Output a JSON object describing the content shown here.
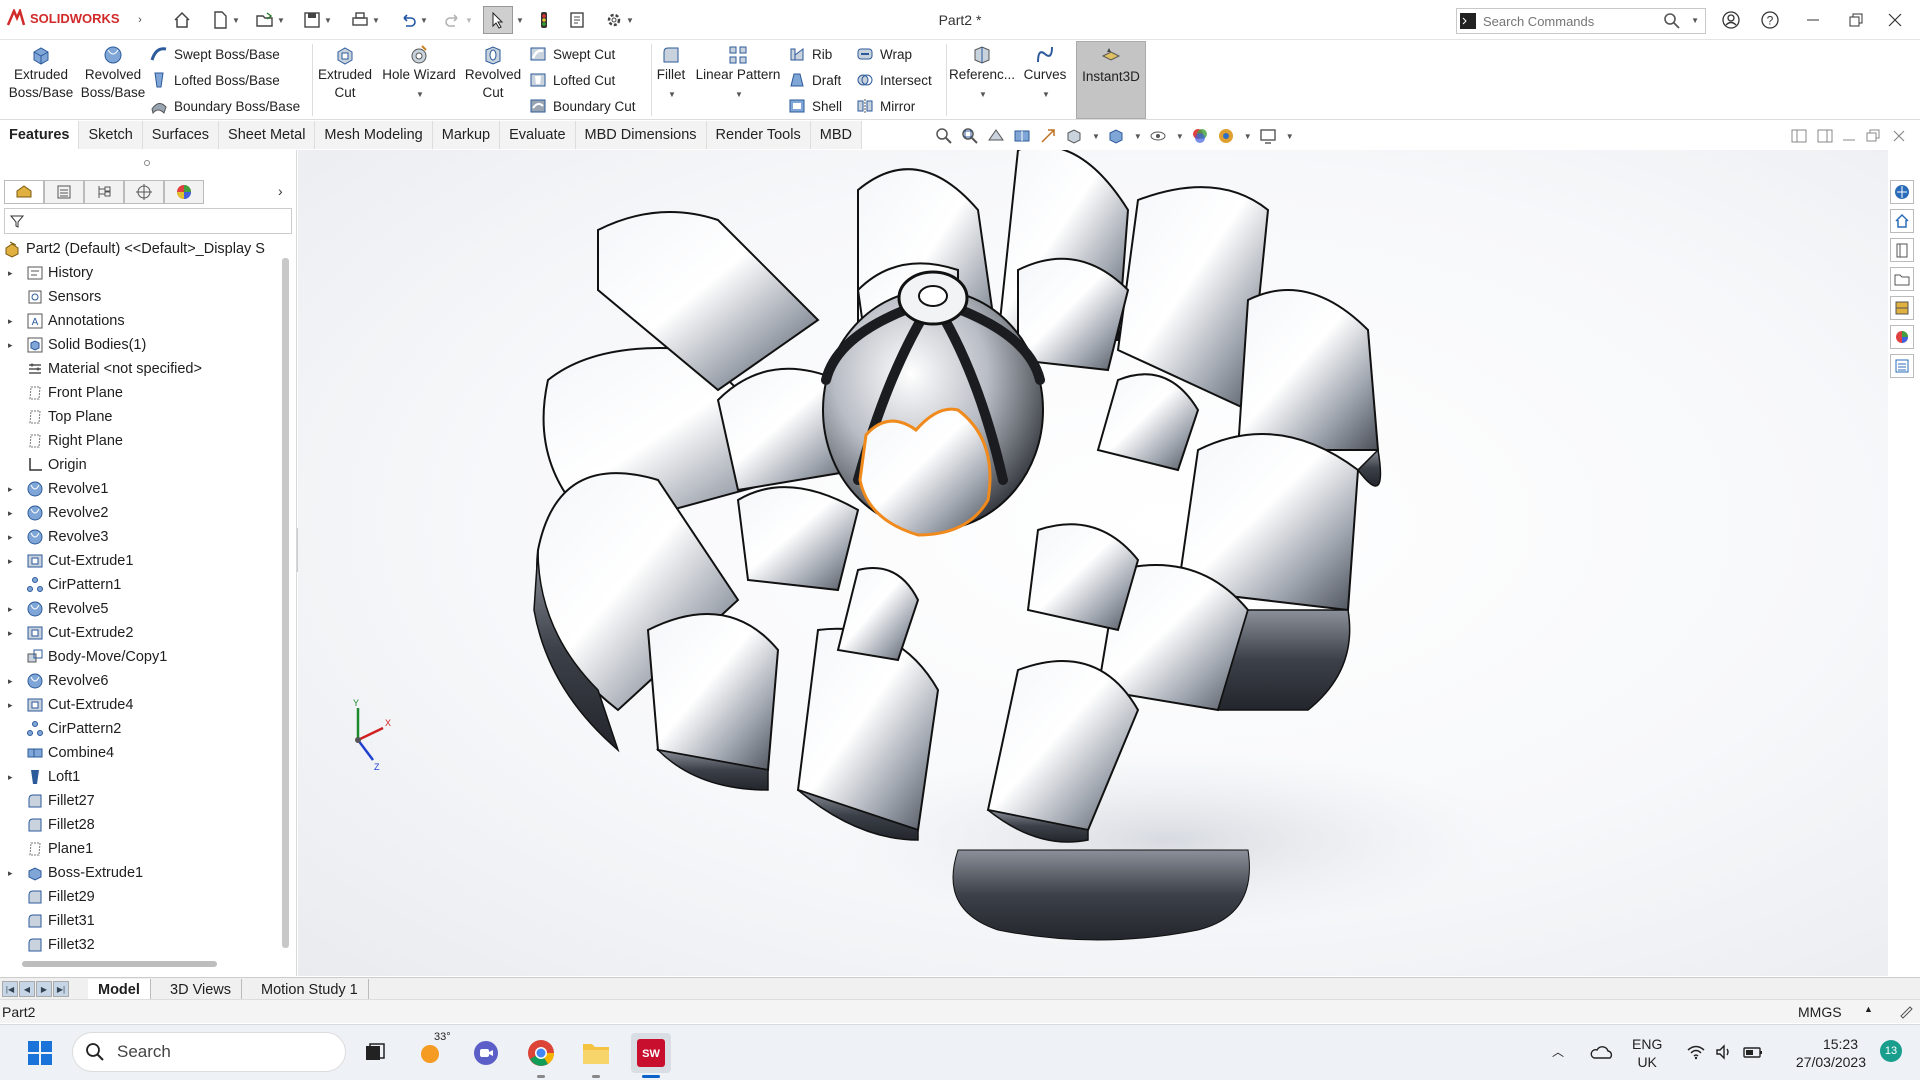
{
  "app": {
    "name": "SOLIDWORKS",
    "doc_title": "Part2 *",
    "search_placeholder": "Search Commands"
  },
  "command_manager": {
    "extruded_boss": "Extruded Boss/Base",
    "revolved_boss": "Revolved Boss/Base",
    "swept_boss": "Swept Boss/Base",
    "lofted_boss": "Lofted Boss/Base",
    "boundary_boss": "Boundary Boss/Base",
    "extruded_cut": "Extruded Cut",
    "hole_wizard": "Hole Wizard",
    "revolved_cut": "Revolved Cut",
    "swept_cut": "Swept Cut",
    "lofted_cut": "Lofted Cut",
    "boundary_cut": "Boundary Cut",
    "fillet": "Fillet",
    "linear_pattern": "Linear Pattern",
    "rib": "Rib",
    "draft": "Draft",
    "shell": "Shell",
    "wrap": "Wrap",
    "intersect": "Intersect",
    "mirror": "Mirror",
    "reference": "Referenc...",
    "curves": "Curves",
    "instant3d": "Instant3D"
  },
  "tabs": [
    "Features",
    "Sketch",
    "Surfaces",
    "Sheet Metal",
    "Mesh Modeling",
    "Markup",
    "Evaluate",
    "MBD Dimensions",
    "Render Tools",
    "MBD"
  ],
  "feature_tree": {
    "root": "Part2 (Default) <<Default>_Display S",
    "items": [
      {
        "label": "History",
        "icon": "history-icon",
        "expand": true
      },
      {
        "label": "Sensors",
        "icon": "sensor-icon",
        "expand": false
      },
      {
        "label": "Annotations",
        "icon": "annotations-icon",
        "expand": true
      },
      {
        "label": "Solid Bodies(1)",
        "icon": "solid-bodies-icon",
        "expand": true
      },
      {
        "label": "Material <not specified>",
        "icon": "material-icon",
        "expand": false
      },
      {
        "label": "Front Plane",
        "icon": "plane-icon",
        "expand": false
      },
      {
        "label": "Top Plane",
        "icon": "plane-icon",
        "expand": false
      },
      {
        "label": "Right Plane",
        "icon": "plane-icon",
        "expand": false
      },
      {
        "label": "Origin",
        "icon": "origin-icon",
        "expand": false
      },
      {
        "label": "Revolve1",
        "icon": "revolve-icon",
        "expand": true
      },
      {
        "label": "Revolve2",
        "icon": "revolve-icon",
        "expand": true
      },
      {
        "label": "Revolve3",
        "icon": "revolve-icon",
        "expand": true
      },
      {
        "label": "Cut-Extrude1",
        "icon": "cut-extrude-icon",
        "expand": true
      },
      {
        "label": "CirPattern1",
        "icon": "circular-pattern-icon",
        "expand": false
      },
      {
        "label": "Revolve5",
        "icon": "revolve-icon",
        "expand": true
      },
      {
        "label": "Cut-Extrude2",
        "icon": "cut-extrude-icon",
        "expand": true
      },
      {
        "label": "Body-Move/Copy1",
        "icon": "move-copy-icon",
        "expand": false
      },
      {
        "label": "Revolve6",
        "icon": "revolve-icon",
        "expand": true
      },
      {
        "label": "Cut-Extrude4",
        "icon": "cut-extrude-icon",
        "expand": true
      },
      {
        "label": "CirPattern2",
        "icon": "circular-pattern-icon",
        "expand": false
      },
      {
        "label": "Combine4",
        "icon": "combine-icon",
        "expand": false
      },
      {
        "label": "Loft1",
        "icon": "loft-icon",
        "expand": true
      },
      {
        "label": "Fillet27",
        "icon": "fillet-icon",
        "expand": false
      },
      {
        "label": "Fillet28",
        "icon": "fillet-icon",
        "expand": false
      },
      {
        "label": "Plane1",
        "icon": "plane-icon",
        "expand": false
      },
      {
        "label": "Boss-Extrude1",
        "icon": "boss-extrude-icon",
        "expand": true
      },
      {
        "label": "Fillet29",
        "icon": "fillet-icon",
        "expand": false
      },
      {
        "label": "Fillet31",
        "icon": "fillet-icon",
        "expand": false
      },
      {
        "label": "Fillet32",
        "icon": "fillet-icon",
        "expand": false
      }
    ]
  },
  "triad": {
    "x": "X",
    "y": "Y",
    "z": "Z"
  },
  "bottom_tabs": [
    "Model",
    "3D Views",
    "Motion Study 1"
  ],
  "status": {
    "left": "Part2",
    "units": "MMGS"
  },
  "taskbar": {
    "search": "Search",
    "weather": "33°",
    "language": "ENG",
    "region": "UK",
    "time": "15:23",
    "date": "27/03/2023",
    "notifications": "13"
  },
  "colors": {
    "accent": "#d12a2a",
    "selection": "#f08a1c",
    "taskbar_active": "#0a62c8"
  }
}
